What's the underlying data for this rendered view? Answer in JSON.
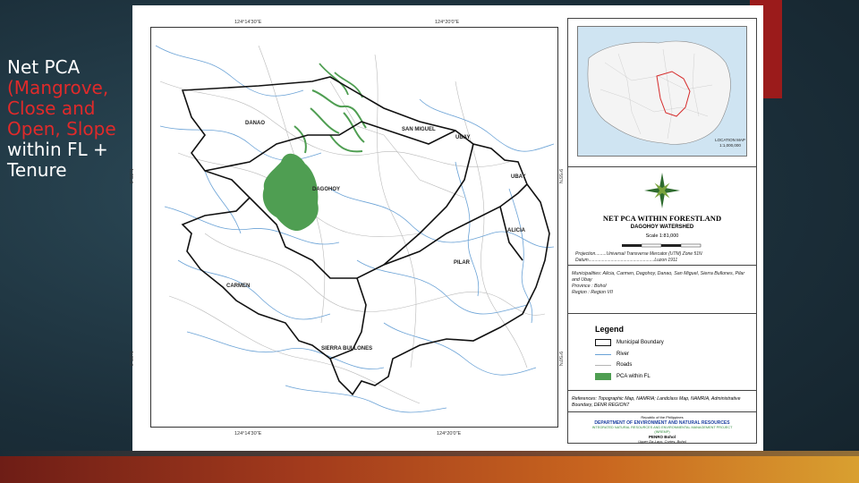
{
  "slide": {
    "line1": "Net PCA",
    "red_lines": [
      "(Mangrove,",
      "Close and",
      "Open, Slope"
    ],
    "white_lines": [
      "within FL +",
      "Tenure"
    ]
  },
  "map": {
    "top_coords": [
      "124°14'30\"E",
      "124°20'0\"E"
    ],
    "bottom_coords": [
      "124°14'30\"E",
      "124°20'0\"E"
    ],
    "left_coords": [
      "9°55'N",
      "9°50'N"
    ],
    "right_coords": [
      "9°55'N",
      "9°50'N"
    ],
    "places": {
      "danao": "DANAO",
      "san_miguel": "SAN MIGUEL",
      "ubay1": "UBAY",
      "ubay2": "UBAY",
      "dagohoy": "DAGOHOY",
      "alicia": "ALICIA",
      "pilar": "PILAR",
      "carmen": "CARMEN",
      "sierra_bullones": "SIERRA BULLONES"
    }
  },
  "panel": {
    "location_map_label": "LOCATION MAP",
    "location_map_scale": "1:1,000,000",
    "title": "NET PCA WITHIN FORESTLAND",
    "subtitle": "DAGOHOY WATERSHED",
    "scale": "Scale 1:81,000",
    "projection": "Projection.........Universal Transverse Mercator (UTM) Zone 51N",
    "datum": "Datum.....................................................Luzon 1911",
    "municipalities": "Municipalities:  Alicia, Carmen, Dagohoy, Danao, San Miguel, Sierra Bullones, Pilar and Ubay",
    "province": "Province    :  Bohol",
    "region": "Region      :  Region VII",
    "legend": {
      "title": "Legend",
      "items": [
        {
          "label": "Municipal Boundary"
        },
        {
          "label": "River"
        },
        {
          "label": "Roads"
        },
        {
          "label": "PCA within FL"
        }
      ]
    },
    "references": "References:  Topographic Map, NAMRIA; Landclass Map, NAMRIA, Administrative Boundary, DENR REGION7",
    "agency_republic": "Republic of the Philippines",
    "agency_dept": "DEPARTMENT OF ENVIRONMENT AND NATURAL RESOURCES",
    "agency_project": "INTEGRATED NATURAL RESOURCES AND ENVIRONMENTAL MANAGEMENT PROJECT",
    "agency_inremp": "(INREMP)",
    "agency_penro": "PENRO Bohol",
    "agency_address": "Upper Da-Layo, Cortes, Bohol"
  },
  "colors": {
    "pca": "#4f9e52",
    "river": "#6aa2d6",
    "roads": "#b5b5b5",
    "boundary": "#111111"
  }
}
